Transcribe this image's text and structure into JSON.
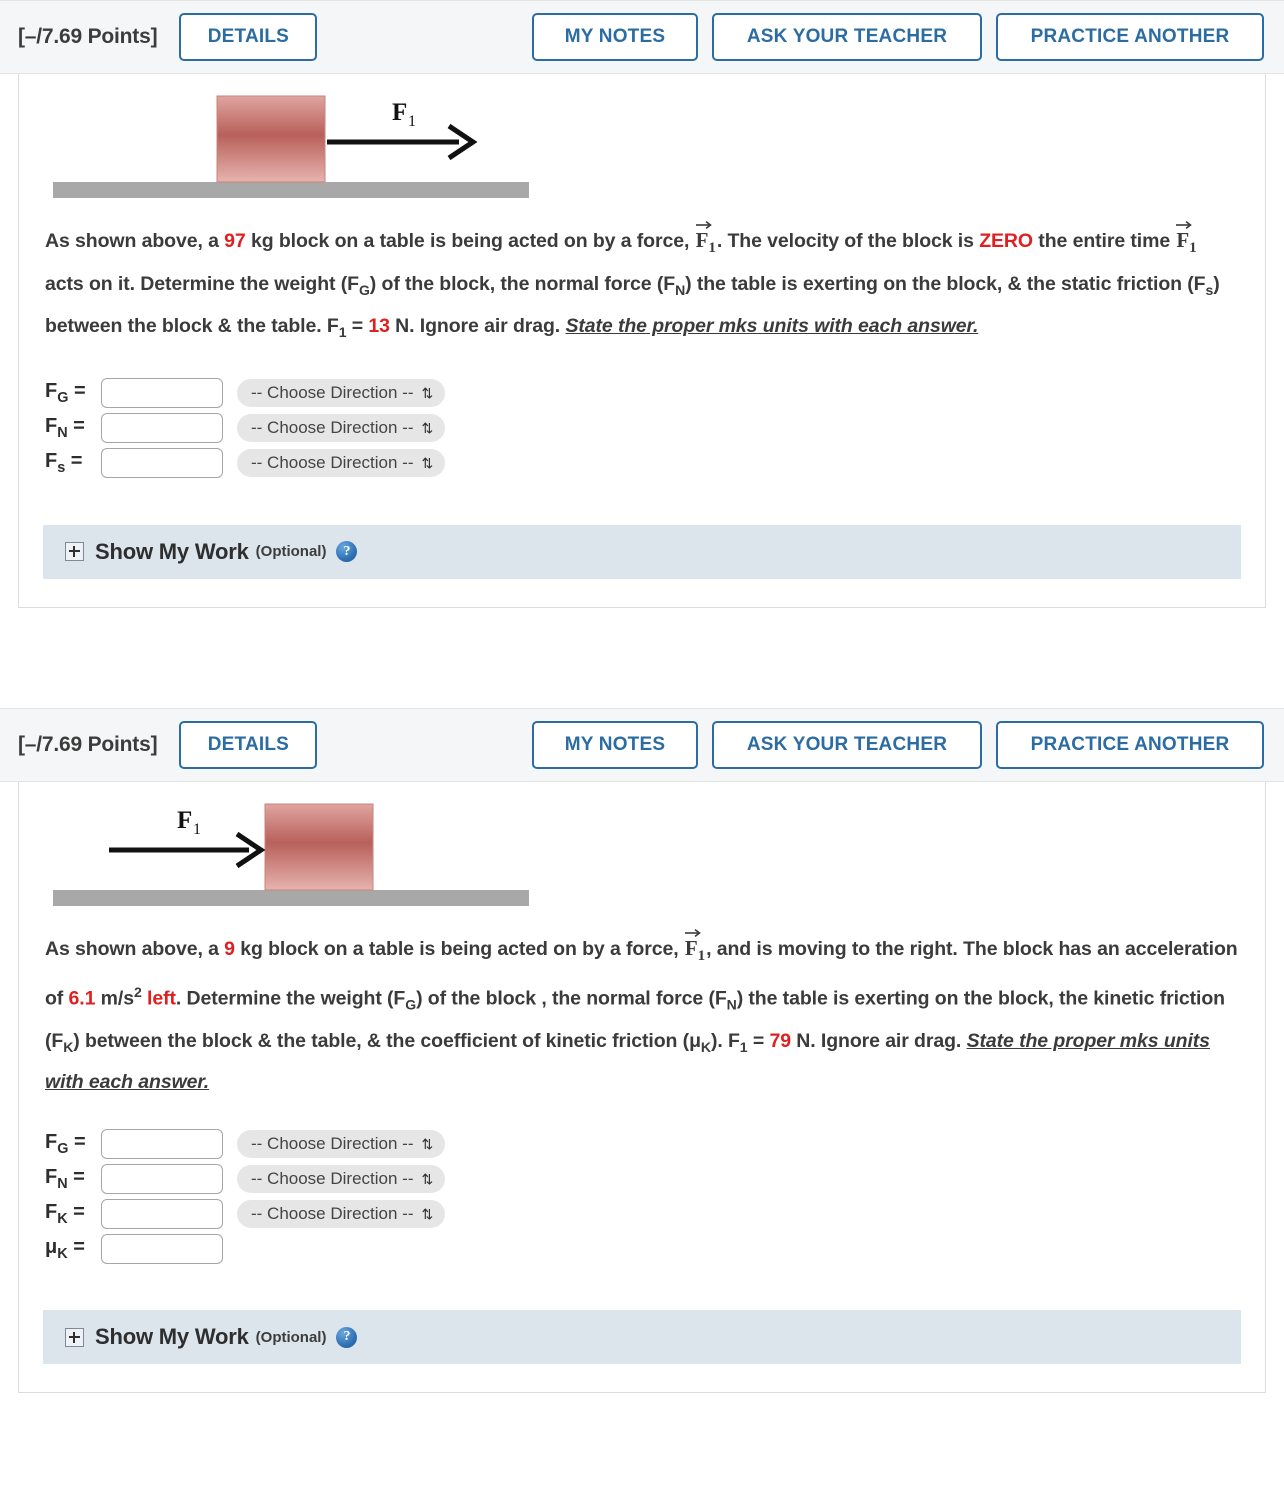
{
  "problems": [
    {
      "points_label": "[–/7.69 Points]",
      "details_label": "DETAILS",
      "my_notes_label": "MY NOTES",
      "ask_teacher_label": "ASK YOUR TEACHER",
      "practice_another_label": "PRACTICE ANOTHER",
      "figure": {
        "force_label": "F",
        "force_sub": "1",
        "arrow_direction": "right",
        "block_position": "center",
        "block_color_light": "#e3a9a4",
        "block_color_dark": "#b45a53",
        "table_color": "#a8a8a8"
      },
      "statement": {
        "t1": "As shown above, a ",
        "mass": "97",
        "t2": " kg block on a table is being acted on by a force, ",
        "t3": ". The velocity of the block is ",
        "velocity": "ZERO",
        "t4": " the entire time ",
        "t5": " acts on it. Determine the weight (F",
        "sub_g": "G",
        "t6": ") of the block, the normal force (F",
        "sub_n": "N",
        "t7": ") the table is exerting on the block, & the static friction (F",
        "sub_s": "s",
        "t8": ") between the block & the table. F",
        "sub_1": "1",
        "t9": " = ",
        "force_value": "13",
        "t10": " N. Ignore air drag. ",
        "emphasis": "State the proper mks units with each answer."
      },
      "answers": [
        {
          "label": "F",
          "sub": "G",
          "value": "",
          "select": "-- Choose Direction --",
          "has_select": true
        },
        {
          "label": "F",
          "sub": "N",
          "value": "",
          "select": "-- Choose Direction --",
          "has_select": true
        },
        {
          "label": "F",
          "sub": "s",
          "value": "",
          "select": "-- Choose Direction --",
          "has_select": true
        }
      ],
      "show_my_work": {
        "title": "Show My Work",
        "optional": "(Optional)",
        "help": "?",
        "expand": "+"
      }
    },
    {
      "points_label": "[–/7.69 Points]",
      "details_label": "DETAILS",
      "my_notes_label": "MY NOTES",
      "ask_teacher_label": "ASK YOUR TEACHER",
      "practice_another_label": "PRACTICE ANOTHER",
      "figure": {
        "force_label": "F",
        "force_sub": "1",
        "arrow_direction": "right",
        "block_position": "right-of-arrow",
        "block_color_light": "#e3a9a4",
        "block_color_dark": "#b45a53",
        "table_color": "#a8a8a8"
      },
      "statement": {
        "t1": "As shown above, a ",
        "mass": "9",
        "t2": " kg block on a table is being acted on by a force, ",
        "t3": ", and is moving to the right. The block has an acceleration of ",
        "accel": "6.1",
        "t4": " m/s",
        "accel_exp": "2",
        "accel_dir": "left",
        "t5": ". Determine the weight (F",
        "sub_g": "G",
        "t6": ") of the block , the normal force (F",
        "sub_n": "N",
        "t7": ") the table is exerting on the block, the kinetic friction (F",
        "sub_k": "K",
        "t8": ") between the block & the table, & the coefficient of kinetic friction (",
        "mu_k": "μ",
        "mu_k_sub": "K",
        "t9": "). F",
        "sub_1": "1",
        "t10": " = ",
        "force_value": "79",
        "t11": " N. Ignore air drag. ",
        "emphasis": "State the proper mks units with each answer."
      },
      "answers": [
        {
          "label": "F",
          "sub": "G",
          "value": "",
          "select": "-- Choose Direction --",
          "has_select": true
        },
        {
          "label": "F",
          "sub": "N",
          "value": "",
          "select": "-- Choose Direction --",
          "has_select": true
        },
        {
          "label": "F",
          "sub": "K",
          "value": "",
          "select": "-- Choose Direction --",
          "has_select": true
        },
        {
          "label": "μ",
          "sub": "K",
          "value": "",
          "select": "",
          "has_select": false
        }
      ],
      "show_my_work": {
        "title": "Show My Work",
        "optional": "(Optional)",
        "help": "?",
        "expand": "+"
      }
    }
  ]
}
